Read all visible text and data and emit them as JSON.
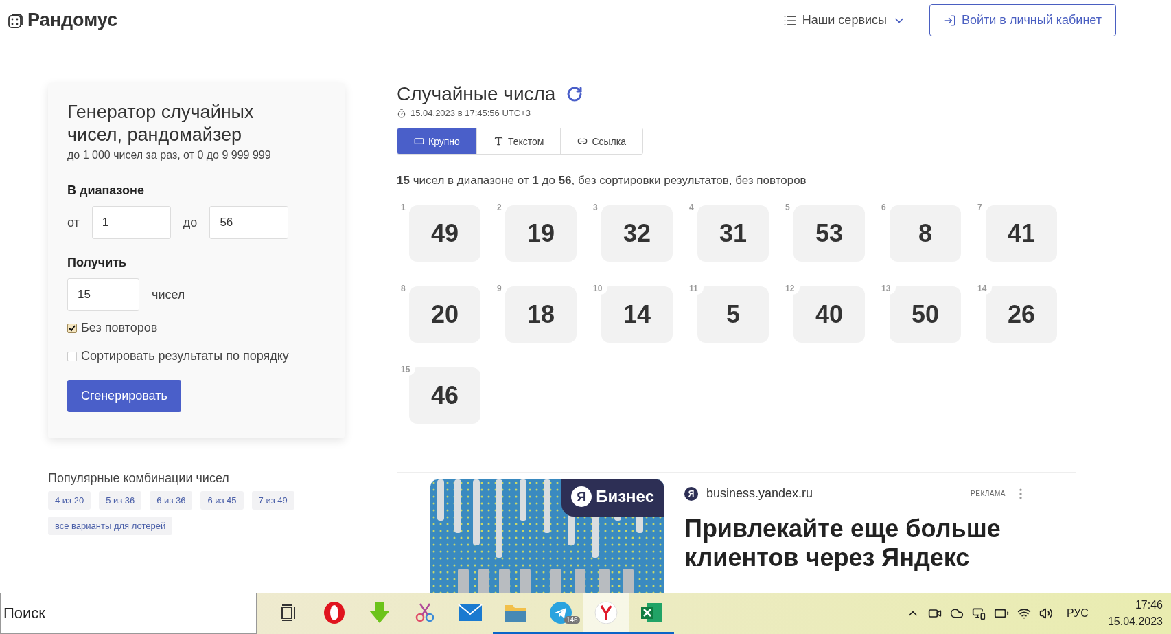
{
  "header": {
    "logo": "Рандомус",
    "services": "Наши сервисы",
    "login": "Войти в личный кабинет"
  },
  "generator": {
    "title": "Генератор случайных чисел, рандомайзер",
    "subtitle": "до 1 000 чисел за раз, от 0 до 9 999 999",
    "range_label": "В диапазоне",
    "from_label": "от",
    "from_value": "1",
    "to_label": "до",
    "to_value": "56",
    "get_label": "Получить",
    "count_value": "15",
    "count_unit": "чисел",
    "options": [
      {
        "label": "Без повторов",
        "checked": true
      },
      {
        "label": "Сортировать результаты по порядку",
        "checked": false
      }
    ],
    "button": "Сгенерировать"
  },
  "popular": {
    "title": "Популярные комбинации чисел",
    "chips": [
      "4 из 20",
      "5 из 36",
      "6 из 36",
      "6 из 45",
      "7 из 49",
      "все варианты для лотерей"
    ]
  },
  "results": {
    "title": "Случайные числа",
    "timestamp": "15.04.2023 в 17:45:56 UTC+3",
    "tabs": [
      {
        "label": "Крупно",
        "kind": "large",
        "selected": true
      },
      {
        "label": "Текстом",
        "kind": "text",
        "selected": false
      },
      {
        "label": "Ссылка",
        "kind": "link",
        "selected": false
      }
    ],
    "summary": "**15** чисел в диапазоне от **1** до **56**, без сортировки результатов, без повторов",
    "numbers": [
      {
        "index": "1",
        "value": "49"
      },
      {
        "index": "2",
        "value": "19"
      },
      {
        "index": "3",
        "value": "32"
      },
      {
        "index": "4",
        "value": "31"
      },
      {
        "index": "5",
        "value": "53"
      },
      {
        "index": "6",
        "value": "8"
      },
      {
        "index": "7",
        "value": "41"
      },
      {
        "index": "8",
        "value": "20"
      },
      {
        "index": "9",
        "value": "18"
      },
      {
        "index": "10",
        "value": "14"
      },
      {
        "index": "11",
        "value": "5"
      },
      {
        "index": "12",
        "value": "40"
      },
      {
        "index": "13",
        "value": "50"
      },
      {
        "index": "14",
        "value": "26"
      },
      {
        "index": "15",
        "value": "46"
      }
    ]
  },
  "ad": {
    "badge_letter": "Я",
    "badge_text": "Бизнес",
    "domain_letter": "Я",
    "domain": "business.yandex.ru",
    "label": "РЕКЛАМА",
    "headline": "Привлекайте еще больше клиентов через Яндекс"
  },
  "taskbar": {
    "search_placeholder": "Поиск",
    "apps": [
      {
        "kind": "taskview",
        "open": false,
        "selected": false
      },
      {
        "kind": "opera",
        "open": false,
        "selected": false
      },
      {
        "kind": "download",
        "open": false,
        "selected": false
      },
      {
        "kind": "scissors",
        "open": false,
        "selected": false
      },
      {
        "kind": "mail",
        "open": false,
        "selected": false
      },
      {
        "kind": "folder",
        "open": true,
        "selected": false
      },
      {
        "kind": "telegram",
        "open": true,
        "selected": false,
        "badge": "146"
      },
      {
        "kind": "yandex",
        "open": true,
        "selected": true
      },
      {
        "kind": "excel",
        "open": true,
        "selected": false
      }
    ],
    "language": "РУС",
    "time": "17:46",
    "date": "15.04.2023"
  }
}
